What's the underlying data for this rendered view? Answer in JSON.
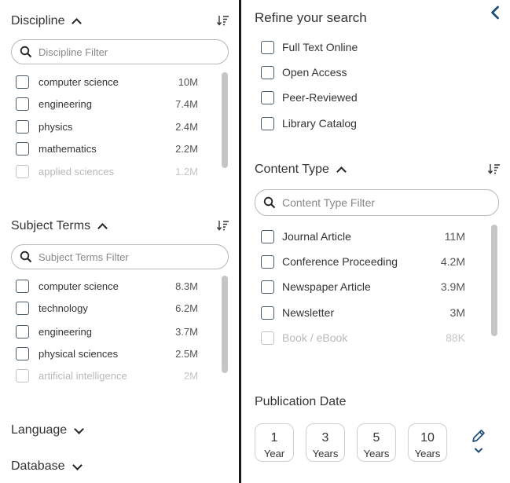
{
  "left": {
    "discipline": {
      "title": "Discipline",
      "filter_placeholder": "Discipline Filter",
      "items": [
        {
          "label": "computer science",
          "count": "10M"
        },
        {
          "label": "engineering",
          "count": "7.4M"
        },
        {
          "label": "physics",
          "count": "2.4M"
        },
        {
          "label": "mathematics",
          "count": "2.2M"
        },
        {
          "label": "applied sciences",
          "count": "1.2M"
        }
      ]
    },
    "subject_terms": {
      "title": "Subject Terms",
      "filter_placeholder": "Subject Terms Filter",
      "items": [
        {
          "label": "computer science",
          "count": "8.3M"
        },
        {
          "label": "technology",
          "count": "6.2M"
        },
        {
          "label": "engineering",
          "count": "3.7M"
        },
        {
          "label": "physical sciences",
          "count": "2.5M"
        },
        {
          "label": "artificial intelligence",
          "count": "2M"
        }
      ]
    },
    "language": {
      "title": "Language"
    },
    "database": {
      "title": "Database"
    }
  },
  "right": {
    "refine": {
      "title": "Refine your search",
      "options": [
        "Full Text Online",
        "Open Access",
        "Peer-Reviewed",
        "Library Catalog"
      ]
    },
    "content_type": {
      "title": "Content Type",
      "filter_placeholder": "Content Type Filter",
      "items": [
        {
          "label": "Journal Article",
          "count": "11M"
        },
        {
          "label": "Conference Proceeding",
          "count": "4.2M"
        },
        {
          "label": "Newspaper Article",
          "count": "3.9M"
        },
        {
          "label": "Newsletter",
          "count": "3M"
        },
        {
          "label": "Book / eBook",
          "count": "88K"
        }
      ]
    },
    "publication_date": {
      "title": "Publication Date",
      "ranges": [
        {
          "num": "1",
          "unit": "Year"
        },
        {
          "num": "3",
          "unit": "Years"
        },
        {
          "num": "5",
          "unit": "Years"
        },
        {
          "num": "10",
          "unit": "Years"
        }
      ]
    }
  },
  "colors": {
    "accent": "#1f4e79",
    "divider": "#1a1a1a",
    "scrollbar": "#c6c6c6"
  },
  "icons": [
    "chevron-up-icon",
    "chevron-down-icon",
    "sort-icon",
    "search-icon",
    "back-chevron-icon",
    "pencil-icon"
  ]
}
